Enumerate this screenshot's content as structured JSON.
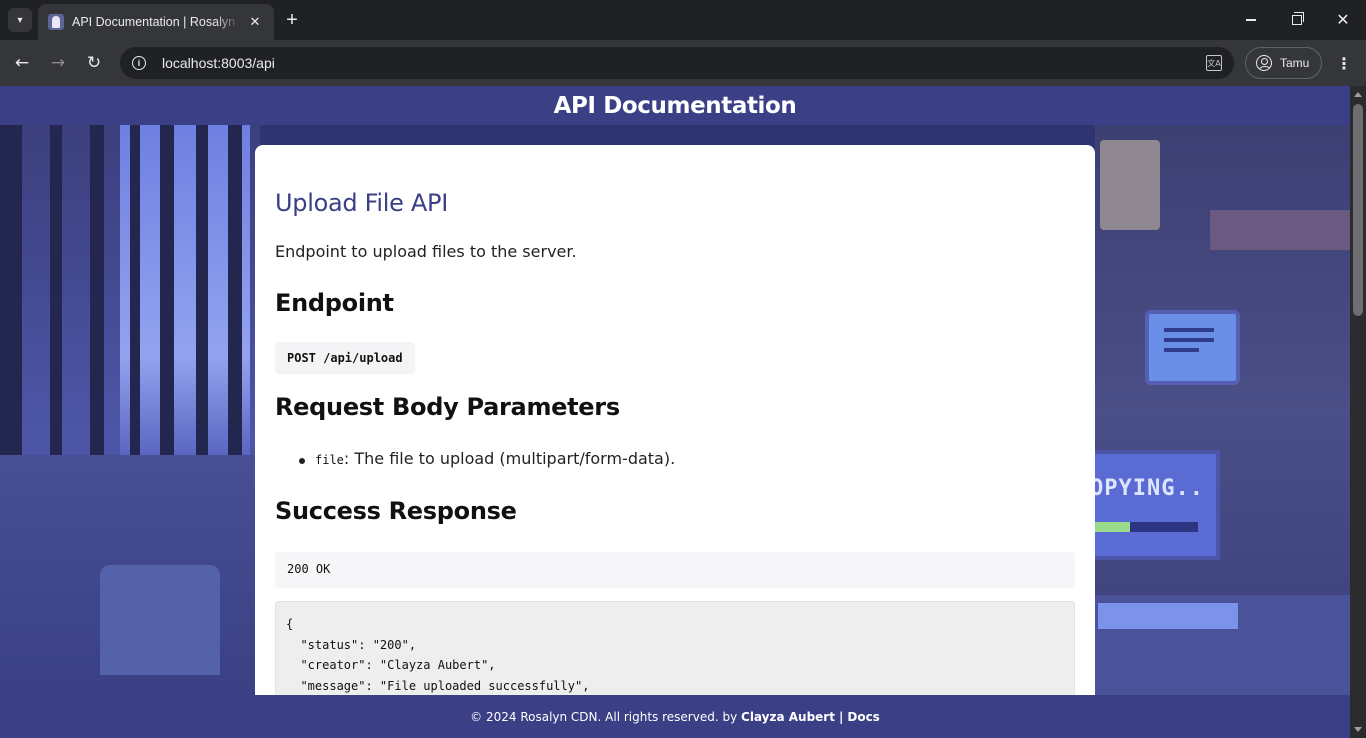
{
  "browser": {
    "tab_title": "API Documentation | Rosalyn CDN",
    "url": "localhost:8003/api",
    "profile_name": "Tamu",
    "icons": {
      "tab_search": "chevron-down-icon",
      "new_tab": "plus-icon",
      "back": "arrow-left-icon",
      "forward": "arrow-right-icon",
      "reload": "reload-icon",
      "site_info": "info-icon",
      "translate": "translate-icon",
      "profile": "person-icon",
      "menu": "kebab-menu-icon"
    }
  },
  "header": {
    "title": "API Documentation"
  },
  "content": {
    "api_title": "Upload File API",
    "api_description": "Endpoint to upload files to the server.",
    "endpoint_heading": "Endpoint",
    "endpoint_code": "POST /api/upload",
    "params_heading": "Request Body Parameters",
    "params": [
      {
        "name": "file",
        "description": ": The file to upload (multipart/form-data)."
      }
    ],
    "success_heading": "Success Response",
    "status_code": "200 OK",
    "response_body": "{\n  \"status\": \"200\",\n  \"creator\": \"Clayza Aubert\",\n  \"message\": \"File uploaded successfully\","
  },
  "background": {
    "monitor_text": "OPYING.."
  },
  "footer": {
    "copyright": "© 2024 Rosalyn CDN. All rights reserved. by",
    "author": "Clayza Aubert",
    "separator": "|",
    "docs_link": "Docs"
  },
  "colors": {
    "brand": "#3a3f86",
    "card_bg": "#ffffff",
    "browser_dark": "#202124"
  }
}
